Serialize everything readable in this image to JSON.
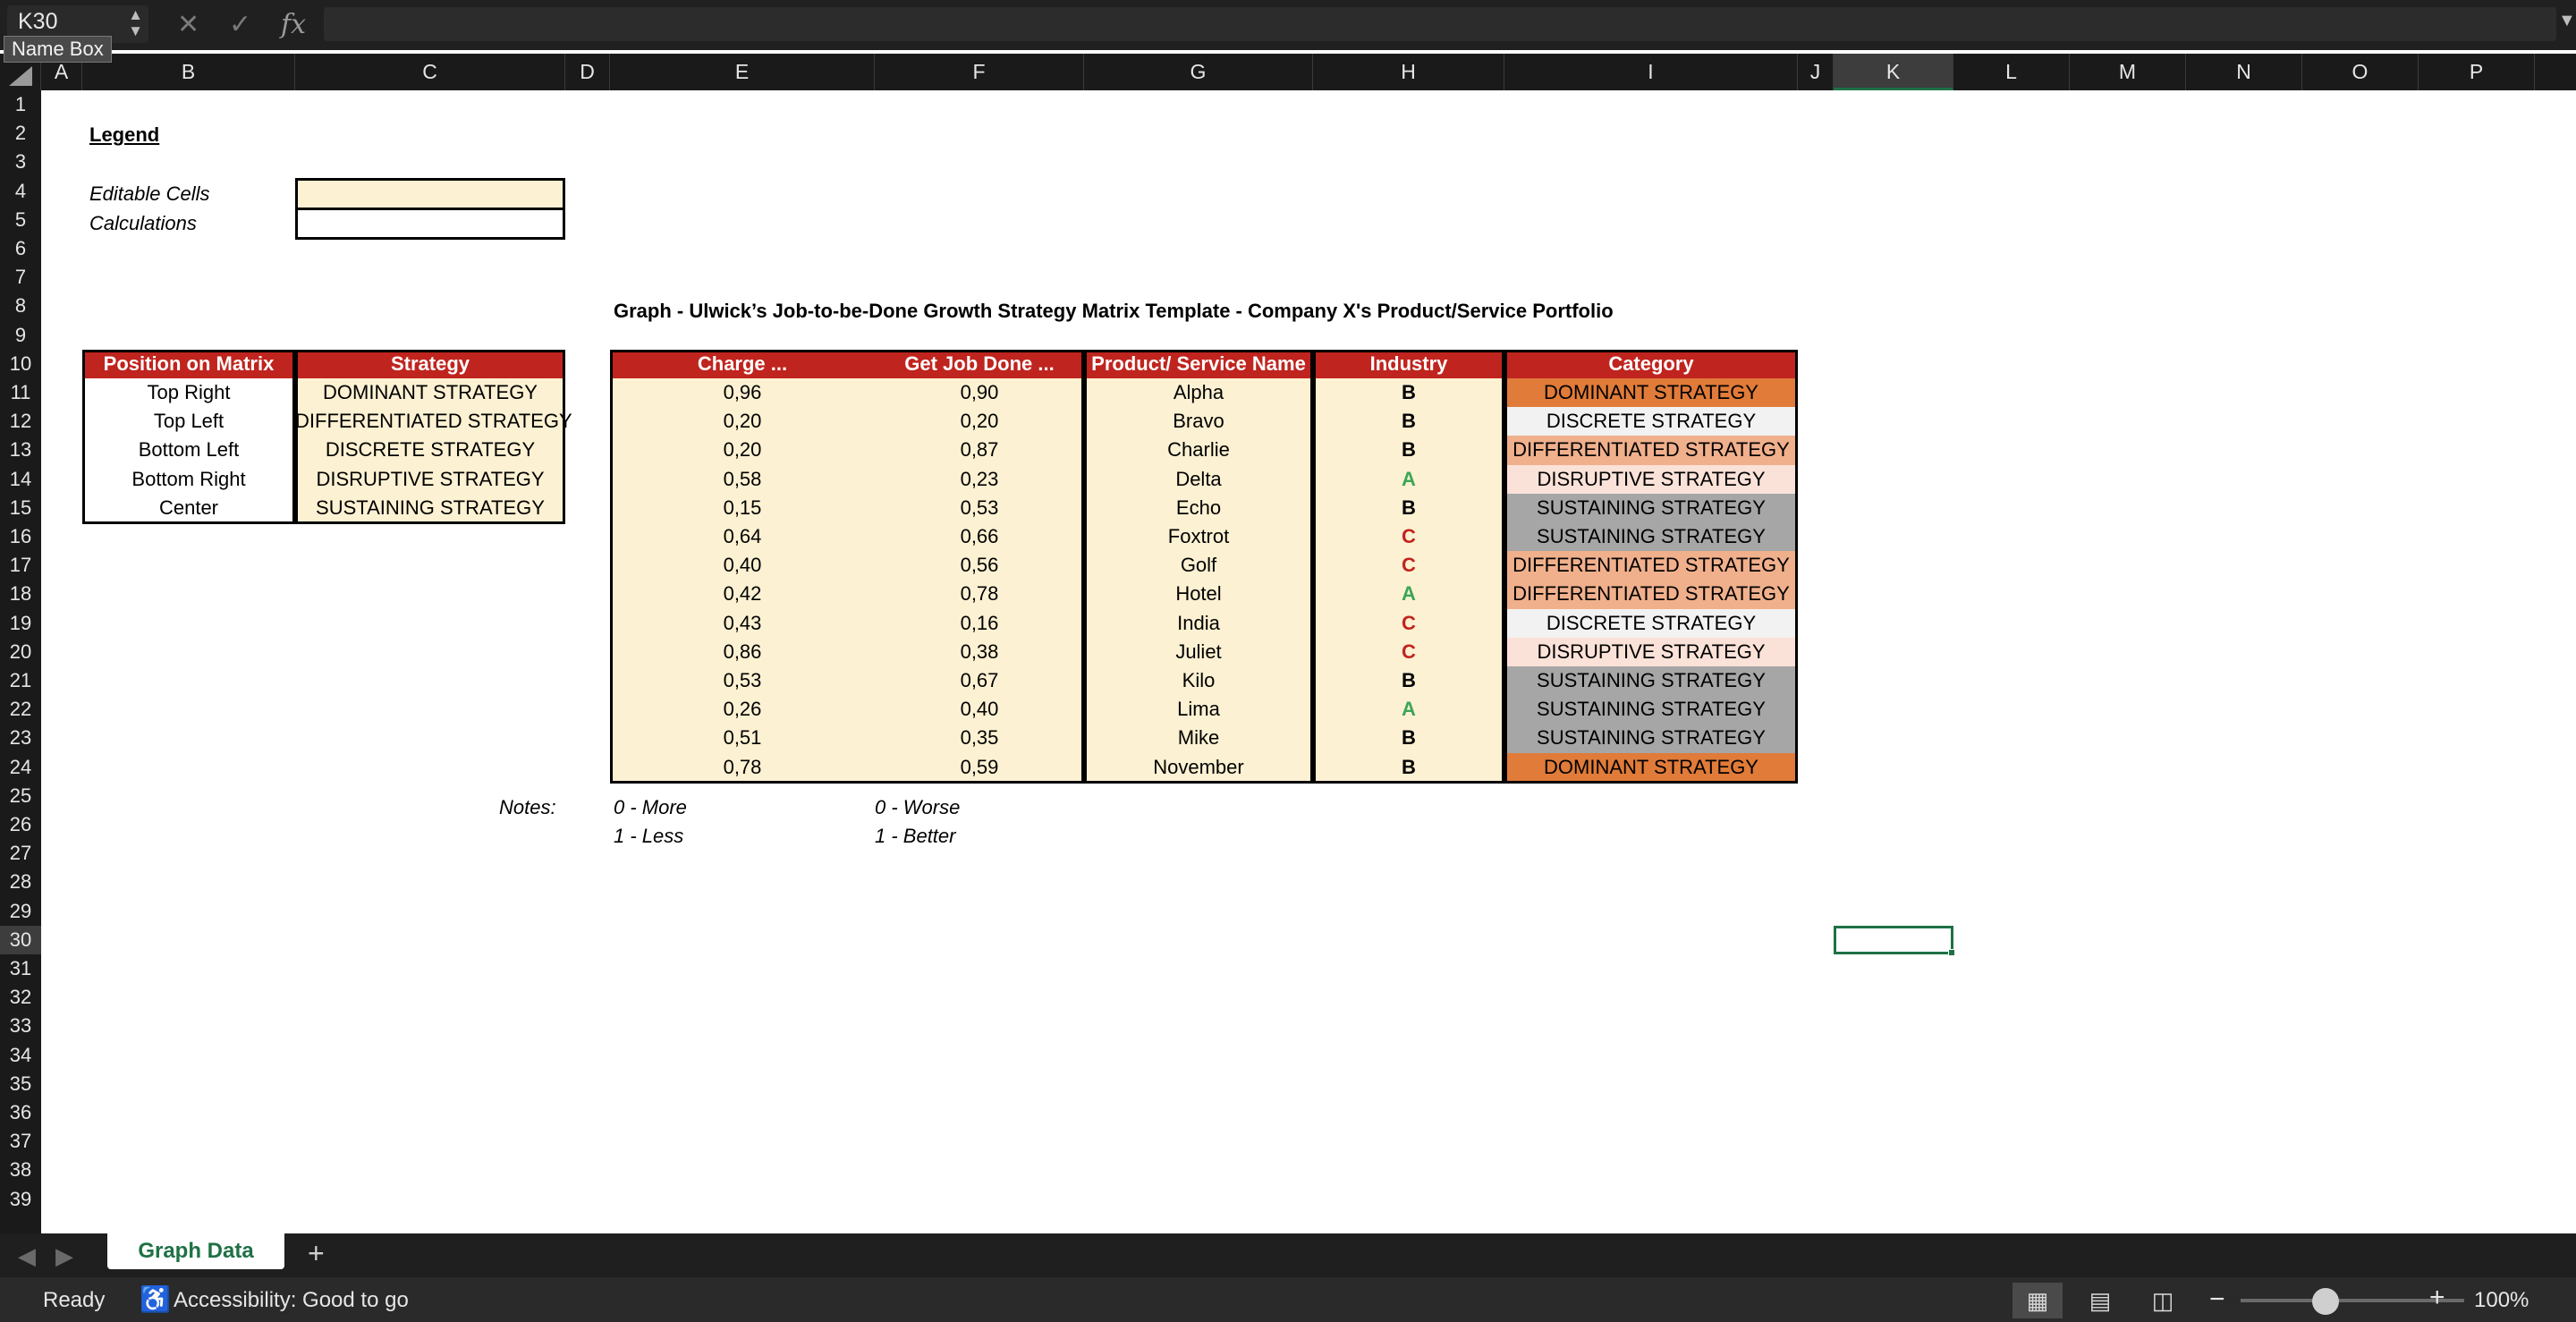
{
  "formula_bar": {
    "name_box": "K30",
    "name_box_tooltip": "Name Box",
    "cancel_icon": "✕",
    "enter_icon": "✓",
    "fx_icon": "fx",
    "formula": ""
  },
  "columns": [
    "A",
    "B",
    "C",
    "D",
    "E",
    "F",
    "G",
    "H",
    "I",
    "J",
    "K",
    "L",
    "M",
    "N",
    "O",
    "P"
  ],
  "rows": [
    "1",
    "2",
    "3",
    "4",
    "5",
    "6",
    "7",
    "8",
    "9",
    "10",
    "11",
    "12",
    "13",
    "14",
    "15",
    "16",
    "17",
    "18",
    "19",
    "20",
    "21",
    "22",
    "23",
    "24",
    "25",
    "26",
    "27",
    "28",
    "29",
    "30",
    "31",
    "32",
    "33",
    "34",
    "35",
    "36",
    "37",
    "38",
    "39"
  ],
  "selected_cell": {
    "column": "K",
    "row": "30"
  },
  "legend": {
    "title": "Legend",
    "editable_label": "Editable Cells",
    "calculations_label": "Calculations"
  },
  "graph_title": "Graph - Ulwick’s Job-to-be-Done Growth Strategy Matrix Template - Company X's Product/Service Portfolio",
  "position_table": {
    "headers": [
      "Position on Matrix",
      "Strategy"
    ],
    "rows": [
      [
        "Top Right",
        "DOMINANT STRATEGY"
      ],
      [
        "Top Left",
        "DIFFERENTIATED STRATEGY"
      ],
      [
        "Bottom Left",
        "DISCRETE STRATEGY"
      ],
      [
        "Bottom Right",
        "DISRUPTIVE STRATEGY"
      ],
      [
        "Center",
        "SUSTAINING STRATEGY"
      ]
    ]
  },
  "data_table": {
    "headers": [
      "Charge ...",
      "Get Job Done ...",
      "Product/ Service Name",
      "Industry",
      "Category"
    ],
    "rows": [
      {
        "charge": "0,96",
        "job": "0,90",
        "name": "Alpha",
        "industry": "B",
        "category": "DOMINANT STRATEGY"
      },
      {
        "charge": "0,20",
        "job": "0,20",
        "name": "Bravo",
        "industry": "B",
        "category": "DISCRETE STRATEGY"
      },
      {
        "charge": "0,20",
        "job": "0,87",
        "name": "Charlie",
        "industry": "B",
        "category": "DIFFERENTIATED STRATEGY"
      },
      {
        "charge": "0,58",
        "job": "0,23",
        "name": "Delta",
        "industry": "A",
        "category": "DISRUPTIVE STRATEGY"
      },
      {
        "charge": "0,15",
        "job": "0,53",
        "name": "Echo",
        "industry": "B",
        "category": "SUSTAINING STRATEGY"
      },
      {
        "charge": "0,64",
        "job": "0,66",
        "name": "Foxtrot",
        "industry": "C",
        "category": "SUSTAINING STRATEGY"
      },
      {
        "charge": "0,40",
        "job": "0,56",
        "name": "Golf",
        "industry": "C",
        "category": "DIFFERENTIATED STRATEGY"
      },
      {
        "charge": "0,42",
        "job": "0,78",
        "name": "Hotel",
        "industry": "A",
        "category": "DIFFERENTIATED STRATEGY"
      },
      {
        "charge": "0,43",
        "job": "0,16",
        "name": "India",
        "industry": "C",
        "category": "DISCRETE STRATEGY"
      },
      {
        "charge": "0,86",
        "job": "0,38",
        "name": "Juliet",
        "industry": "C",
        "category": "DISRUPTIVE STRATEGY"
      },
      {
        "charge": "0,53",
        "job": "0,67",
        "name": "Kilo",
        "industry": "B",
        "category": "SUSTAINING STRATEGY"
      },
      {
        "charge": "0,26",
        "job": "0,40",
        "name": "Lima",
        "industry": "A",
        "category": "SUSTAINING STRATEGY"
      },
      {
        "charge": "0,51",
        "job": "0,35",
        "name": "Mike",
        "industry": "B",
        "category": "SUSTAINING STRATEGY"
      },
      {
        "charge": "0,78",
        "job": "0,59",
        "name": "November",
        "industry": "B",
        "category": "DOMINANT STRATEGY"
      }
    ]
  },
  "notes": {
    "label": "Notes:",
    "charge_0": "0 - More",
    "charge_1": "1 - Less",
    "job_0": "0 - Worse",
    "job_1": "1 - Better"
  },
  "colors": {
    "header_red": "#c0241e",
    "editable_cream": "#fcf1d2",
    "industry_A": "#3aa655",
    "industry_B": "#000000",
    "industry_C": "#c0241e",
    "category": {
      "DOMINANT STRATEGY": "#e07b39",
      "DISCRETE STRATEGY": "#f2f2f2",
      "DIFFERENTIATED STRATEGY": "#f0b08c",
      "DISRUPTIVE STRATEGY": "#fbe2d8",
      "SUSTAINING STRATEGY": "#a6a6a6"
    }
  },
  "tabs": {
    "sheet_name": "Graph Data",
    "add_icon": "+"
  },
  "status_bar": {
    "ready": "Ready",
    "accessibility": "Accessibility: Good to go",
    "zoom": "100%"
  }
}
